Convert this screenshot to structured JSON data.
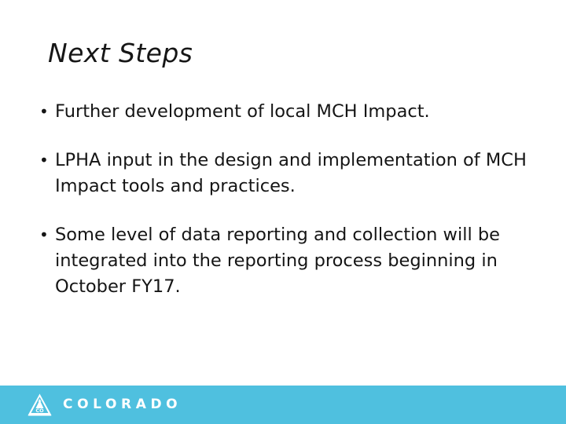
{
  "slide": {
    "title": "Next Steps",
    "background_color": "#ffffff",
    "text_color": "#151515",
    "bullets": [
      {
        "marker": "•",
        "text": "Further development of local MCH Impact."
      },
      {
        "marker": "•",
        "text": "LPHA input in the design and implementation of MCH Impact tools and practices."
      },
      {
        "marker": "•",
        "text": "Some level of data reporting and collection will be integrated into the reporting process beginning in October FY17."
      }
    ]
  },
  "footer": {
    "background_color": "#4FC0DF",
    "logo": {
      "icon_name": "colorado-mountain-triangle-icon",
      "wordmark": "COLORADO",
      "mark_text": "CO",
      "wordmark_color": "#ffffff"
    }
  }
}
